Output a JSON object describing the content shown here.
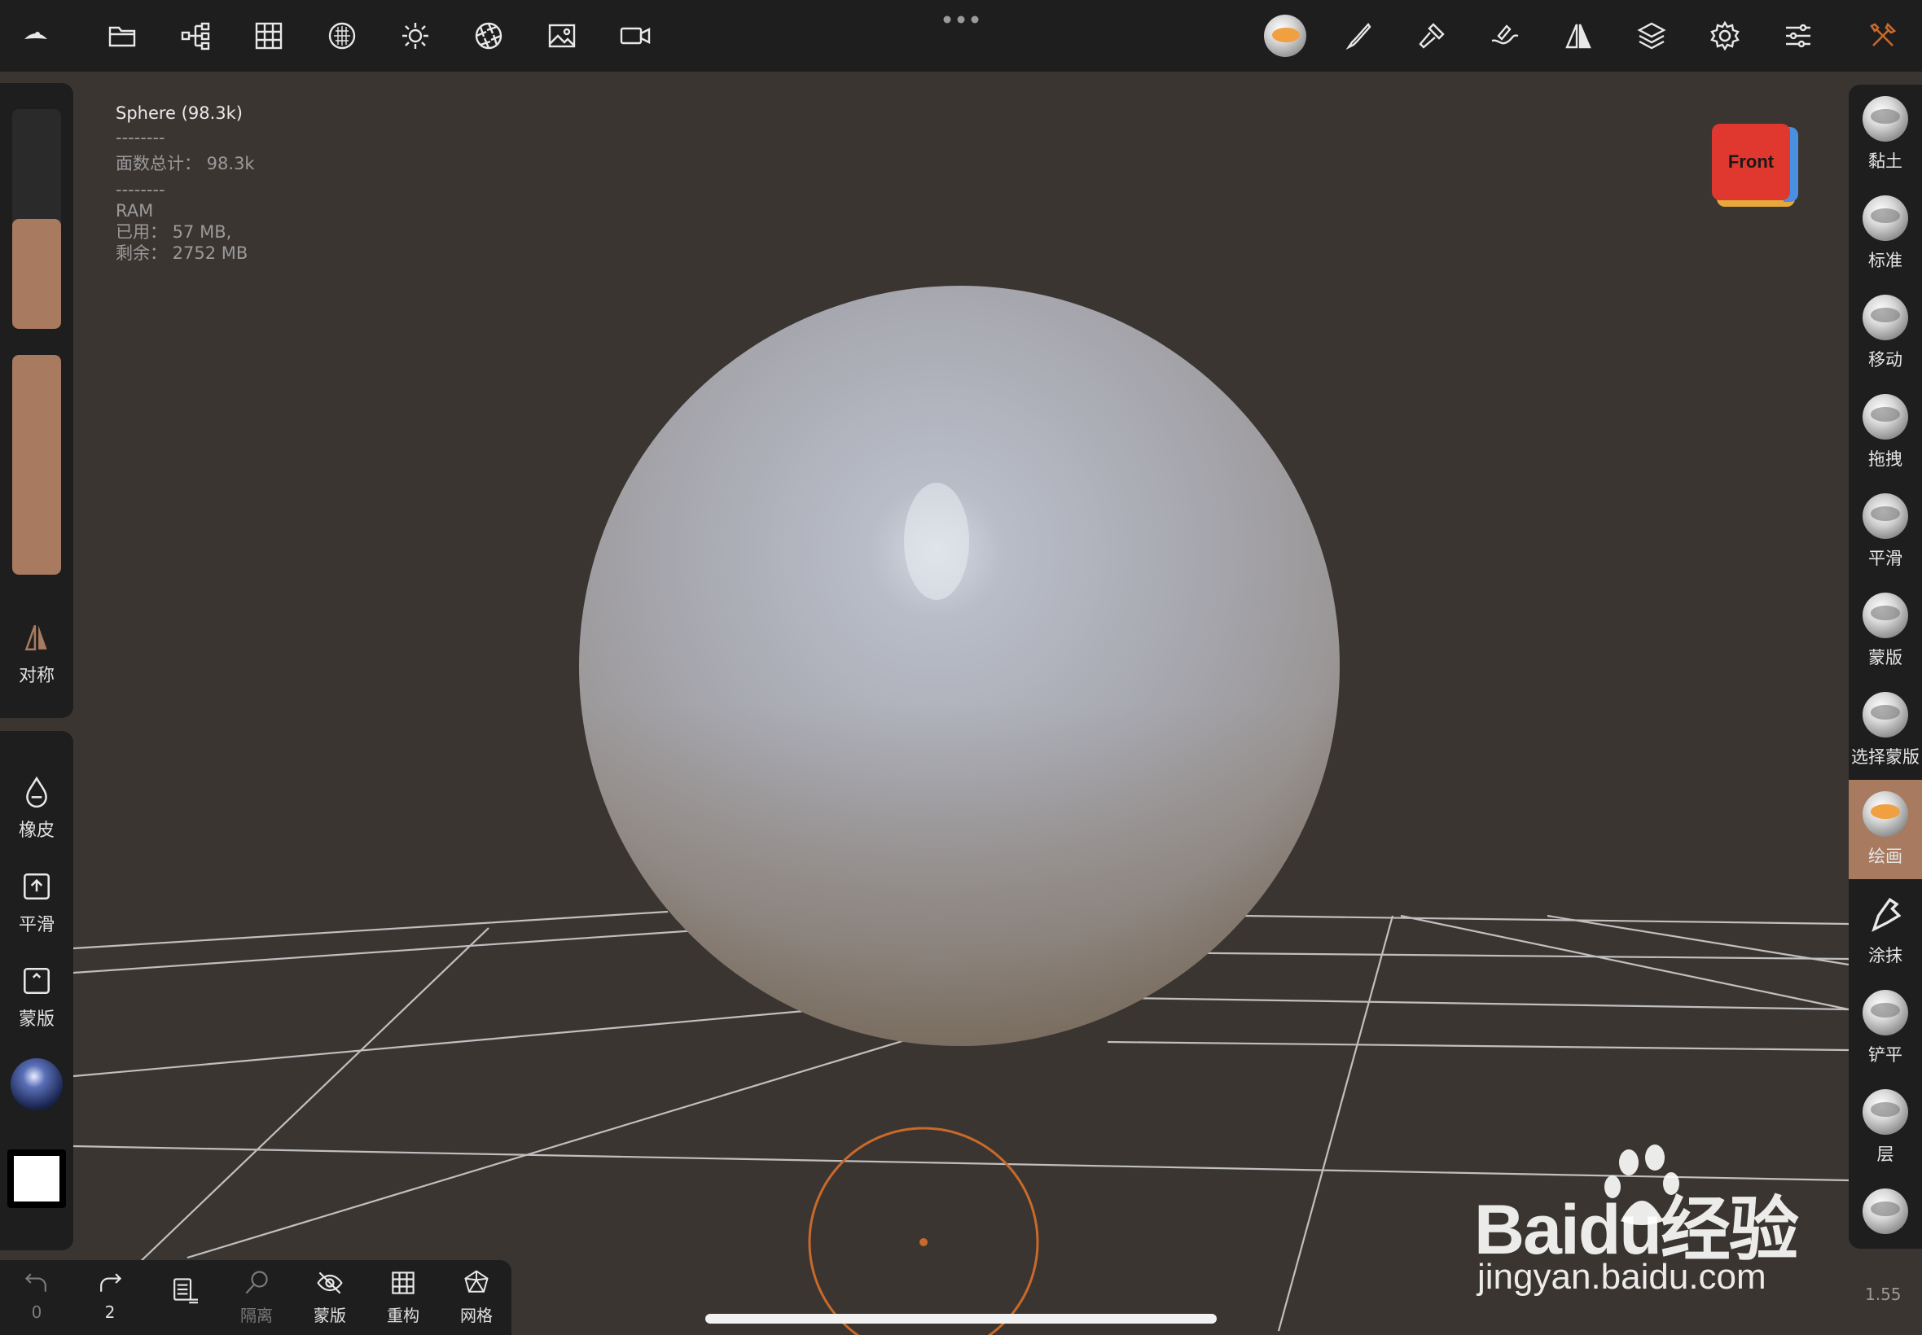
{
  "top_toolbar": {
    "left_icons": [
      "app-logo-icon",
      "folder-icon",
      "scene-tree-icon",
      "grid-icon",
      "matcap-sphere-icon",
      "light-icon",
      "camera-aperture-icon",
      "image-icon",
      "video-icon"
    ],
    "right_icons": [
      "active-brush-icon",
      "paint-brush-icon",
      "hammer-icon",
      "stroke-icon",
      "symmetry-icon",
      "layers-icon",
      "settings-icon",
      "sliders-icon",
      "tools-icon"
    ]
  },
  "info": {
    "mesh_name": "Sphere (98.3k)",
    "separator1": "--------",
    "faces_total": "面数总计：  98.3k",
    "separator2": "--------",
    "ram_label": "RAM",
    "ram_used": "已用：  57 MB,",
    "ram_free": "剩余：  2752 MB"
  },
  "view_cube": {
    "label": "Front",
    "front_color": "#e0372e",
    "side_color": "#4a8fe0"
  },
  "left_panel": {
    "radius_slider_level": 0.5,
    "intensity_slider_level": 1.0,
    "symmetry_label": "对称",
    "eraser_label": "橡皮",
    "smooth_label": "平滑",
    "mask_label": "蒙版",
    "accent_color": "#a87a5f"
  },
  "right_tools": [
    {
      "label": "黏土",
      "active": false
    },
    {
      "label": "标准",
      "active": false
    },
    {
      "label": "移动",
      "active": false
    },
    {
      "label": "拖拽",
      "active": false
    },
    {
      "label": "平滑",
      "active": false
    },
    {
      "label": "蒙版",
      "active": false
    },
    {
      "label": "选择蒙版",
      "active": false
    },
    {
      "label": "绘画",
      "active": true
    },
    {
      "label": "涂抹",
      "active": false
    },
    {
      "label": "铲平",
      "active": false
    },
    {
      "label": "层",
      "active": false
    }
  ],
  "bottom_bar": {
    "undo_count": "0",
    "redo_count": "2",
    "isolate_label": "隔离",
    "mask_label": "蒙版",
    "remesh_label": "重构",
    "mesh_label": "网格"
  },
  "version": "1.55",
  "watermark": {
    "brand": "Baidu经验",
    "url": "jingyan.baidu.com"
  },
  "brush_cursor_color": "#c9692a"
}
